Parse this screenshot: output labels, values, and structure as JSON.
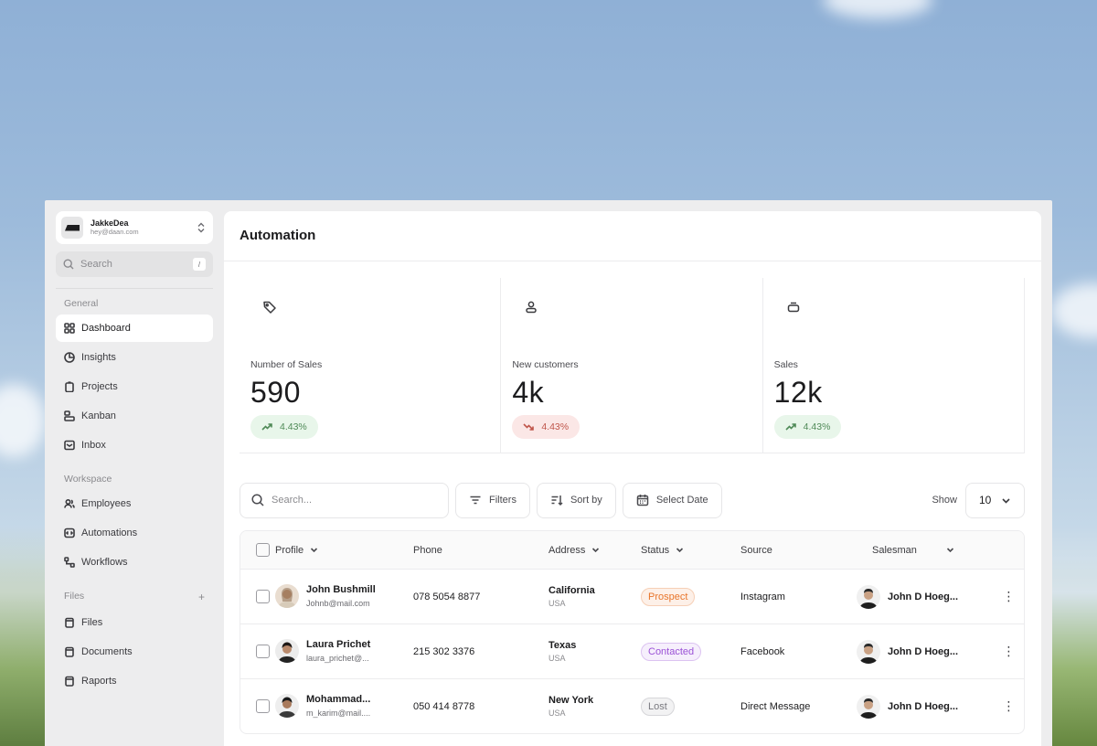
{
  "account": {
    "name": "JakkeDea",
    "email": "hey@daan.com"
  },
  "sidebar": {
    "search_placeholder": "Search",
    "search_shortcut": "/",
    "sections": {
      "general": "General",
      "workspace": "Workspace",
      "files": "Files"
    },
    "general_items": [
      {
        "label": "Dashboard",
        "icon": "grid-icon"
      },
      {
        "label": "Insights",
        "icon": "pie-chart-icon"
      },
      {
        "label": "Projects",
        "icon": "clipboard-icon"
      },
      {
        "label": "Kanban",
        "icon": "kanban-icon"
      },
      {
        "label": "Inbox",
        "icon": "inbox-icon"
      }
    ],
    "workspace_items": [
      {
        "label": "Employees",
        "icon": "users-icon"
      },
      {
        "label": "Automations",
        "icon": "automation-icon"
      },
      {
        "label": "Workflows",
        "icon": "workflow-icon"
      }
    ],
    "files_items": [
      {
        "label": "Files",
        "icon": "file-icon"
      },
      {
        "label": "Documents",
        "icon": "document-icon"
      },
      {
        "label": "Raports",
        "icon": "report-icon"
      }
    ],
    "files_add": "+"
  },
  "main": {
    "title": "Automation",
    "stats": [
      {
        "label": "Number of Sales",
        "value": "590",
        "change": "4.43%",
        "trend": "up",
        "icon": "tag-icon"
      },
      {
        "label": "New customers",
        "value": "4k",
        "change": "4.43%",
        "trend": "down",
        "icon": "user-icon"
      },
      {
        "label": "Sales",
        "value": "12k",
        "change": "4.43%",
        "trend": "up",
        "icon": "box-icon"
      }
    ],
    "toolbar": {
      "search_placeholder": "Search...",
      "filters": "Filters",
      "sort_by": "Sort by",
      "select_date": "Select Date",
      "show_label": "Show",
      "show_value": "10"
    },
    "table": {
      "headers": {
        "profile": "Profile",
        "phone": "Phone",
        "address": "Address",
        "status": "Status",
        "source": "Source",
        "salesman": "Salesman"
      },
      "rows": [
        {
          "name": "John Bushmill",
          "email": "Johnb@mail.com",
          "phone": "078 5054 8877",
          "city": "California",
          "country": "USA",
          "status": "Prospect",
          "source": "Instagram",
          "salesman": "John D Hoeg..."
        },
        {
          "name": "Laura Prichet",
          "email": "laura_prichet@...",
          "phone": "215 302 3376",
          "city": "Texas",
          "country": "USA",
          "status": "Contacted",
          "source": "Facebook",
          "salesman": "John D Hoeg..."
        },
        {
          "name": "Mohammad...",
          "email": "m_karim@mail....",
          "phone": "050 414 8778",
          "city": "New York",
          "country": "USA",
          "status": "Lost",
          "source": "Direct Message",
          "salesman": "John D Hoeg..."
        }
      ]
    }
  },
  "colors": {
    "prospect": "#e8752b",
    "contacted": "#9b52d6",
    "lost": "#7a7a80",
    "trend_up": "#4f8a57",
    "trend_down": "#c0564b"
  }
}
